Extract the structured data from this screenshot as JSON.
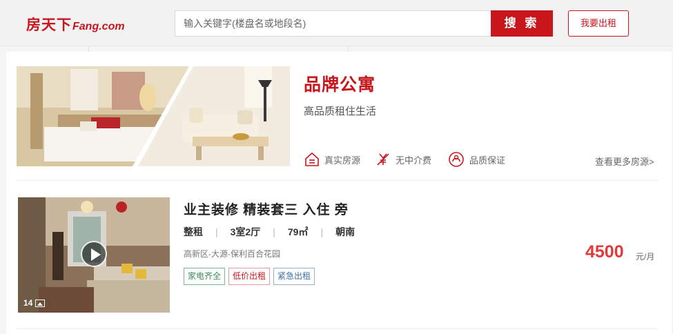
{
  "header": {
    "logo_cn": "房天下",
    "logo_en": "Fang.com",
    "search_placeholder": "输入关键字(楼盘名或地段名)",
    "search_button": "搜 索",
    "rent_button": "我要出租"
  },
  "brand": {
    "title": "品牌公寓",
    "subtitle": "高品质租住生活",
    "features": [
      {
        "label": "真实房源",
        "icon": "house-icon"
      },
      {
        "label": "无中介费",
        "icon": "no-fee-icon"
      },
      {
        "label": "品质保证",
        "icon": "quality-icon"
      }
    ],
    "more_link": "查看更多房源>"
  },
  "listing": {
    "title": "业主装修 精装套三 入住 旁",
    "specs": [
      "整租",
      "3室2厅",
      "79㎡",
      "朝南"
    ],
    "address": "高新区-大源-保利百合花园",
    "tags": [
      "家电齐全",
      "低价出租",
      "紧急出租"
    ],
    "price": "4500",
    "price_unit": "元/月",
    "photo_count": "14"
  },
  "colors": {
    "brand_red": "#c8161d",
    "price_red": "#e4393c"
  }
}
